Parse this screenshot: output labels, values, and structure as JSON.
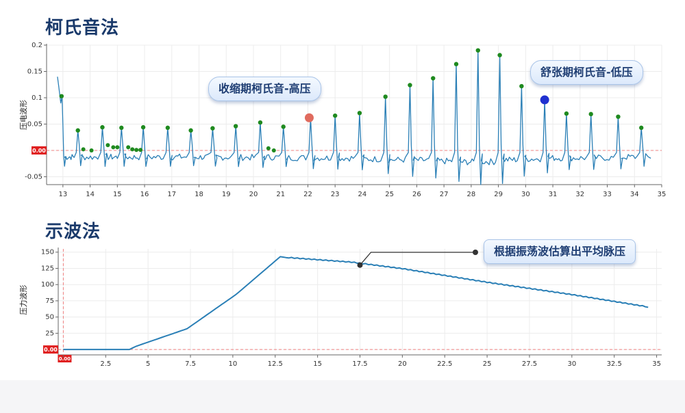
{
  "titles": {
    "top": "柯氏音法",
    "bottom": "示波法"
  },
  "callouts": {
    "systolic": "收缩期柯氏音-高压",
    "diastolic": "舒张期柯氏音-低压",
    "mean": "根据振荡波估算出平均脉压"
  },
  "colors": {
    "title": "#1a3a6b",
    "line": "#2a7fb6",
    "green_marker": "#1f8a1f",
    "systolic_marker": "#e06b5e",
    "diastolic_marker": "#2030d0",
    "baseline": "#f08080"
  },
  "chart_data": [
    {
      "type": "line",
      "ylabel": "压电波形",
      "xlim": [
        12.4,
        35
      ],
      "ylim": [
        -0.065,
        0.2
      ],
      "x_ticks": [
        13,
        14,
        15,
        16,
        17,
        18,
        19,
        20,
        21,
        22,
        23,
        24,
        25,
        26,
        27,
        28,
        29,
        30,
        31,
        32,
        33,
        34,
        35
      ],
      "y_ticks": [
        -0.05,
        0,
        0.05,
        0.1,
        0.15,
        0.2
      ],
      "y_tick_labels": [
        "-0.05",
        "0.00",
        "0.05",
        "0.1",
        "0.15",
        "0.2"
      ],
      "baseline_label": "0.00",
      "peaks": [
        {
          "x": 12.95,
          "y": 0.103
        },
        {
          "x": 13.55,
          "y": 0.038
        },
        {
          "x": 14.45,
          "y": 0.044
        },
        {
          "x": 15.15,
          "y": 0.043
        },
        {
          "x": 15.95,
          "y": 0.044
        },
        {
          "x": 16.85,
          "y": 0.043
        },
        {
          "x": 17.7,
          "y": 0.038
        },
        {
          "x": 18.5,
          "y": 0.042
        },
        {
          "x": 19.35,
          "y": 0.046
        },
        {
          "x": 20.25,
          "y": 0.053
        },
        {
          "x": 21.1,
          "y": 0.045
        },
        {
          "x": 22.1,
          "y": 0.062
        },
        {
          "x": 23.0,
          "y": 0.066
        },
        {
          "x": 23.9,
          "y": 0.071
        },
        {
          "x": 24.85,
          "y": 0.102
        },
        {
          "x": 25.75,
          "y": 0.124
        },
        {
          "x": 26.6,
          "y": 0.137
        },
        {
          "x": 27.45,
          "y": 0.164
        },
        {
          "x": 28.25,
          "y": 0.19
        },
        {
          "x": 29.05,
          "y": 0.181
        },
        {
          "x": 29.85,
          "y": 0.122
        },
        {
          "x": 30.7,
          "y": 0.096
        },
        {
          "x": 31.5,
          "y": 0.07
        },
        {
          "x": 32.4,
          "y": 0.069
        },
        {
          "x": 33.4,
          "y": 0.064
        },
        {
          "x": 34.25,
          "y": 0.043
        }
      ],
      "small_markers": [
        {
          "x": 13.75,
          "y": 0.002
        },
        {
          "x": 14.05,
          "y": 0.0
        },
        {
          "x": 14.65,
          "y": 0.01
        },
        {
          "x": 14.85,
          "y": 0.006
        },
        {
          "x": 15.0,
          "y": 0.006
        },
        {
          "x": 15.4,
          "y": 0.006
        },
        {
          "x": 15.55,
          "y": 0.002
        },
        {
          "x": 15.7,
          "y": 0.001
        },
        {
          "x": 15.85,
          "y": 0.001
        },
        {
          "x": 20.55,
          "y": 0.004
        },
        {
          "x": 20.75,
          "y": 0.0
        }
      ],
      "systolic_point": {
        "x": 22.05,
        "y": 0.062
      },
      "diastolic_point": {
        "x": 30.7,
        "y": 0.096
      }
    },
    {
      "type": "line",
      "ylabel": "压力波形",
      "xlim": [
        -0.3,
        35.3
      ],
      "ylim": [
        -2,
        155
      ],
      "x_ticks": [
        0,
        2.5,
        5,
        7.5,
        10,
        12.5,
        15,
        17.5,
        20,
        22.5,
        25,
        27.5,
        30,
        32.5,
        35
      ],
      "x_tick_labels": [
        "0",
        "2.5",
        "5",
        "7.5",
        "10",
        "12.5",
        "15",
        "17.5",
        "20",
        "22.5",
        "25",
        "27.5",
        "30",
        "32.5",
        "35"
      ],
      "y_ticks": [
        0,
        25,
        50,
        75,
        100,
        125,
        150
      ],
      "y_tick_labels": [
        "0",
        "25",
        "50",
        "75",
        "100",
        "125",
        "150"
      ],
      "baseline_label": "0.00",
      "origin_label": "0.00",
      "curve": [
        {
          "x": 0,
          "y": 0
        },
        {
          "x": 3.9,
          "y": 0
        },
        {
          "x": 4.3,
          "y": 5
        },
        {
          "x": 7.3,
          "y": 32
        },
        {
          "x": 10.2,
          "y": 85
        },
        {
          "x": 12.8,
          "y": 143
        },
        {
          "x": 13.3,
          "y": 141
        },
        {
          "x": 17.0,
          "y": 134
        },
        {
          "x": 20.0,
          "y": 124
        },
        {
          "x": 25.0,
          "y": 103
        },
        {
          "x": 30.0,
          "y": 84
        },
        {
          "x": 34.5,
          "y": 65
        }
      ],
      "annotation_point": {
        "x": 17.5,
        "y": 130
      }
    }
  ]
}
